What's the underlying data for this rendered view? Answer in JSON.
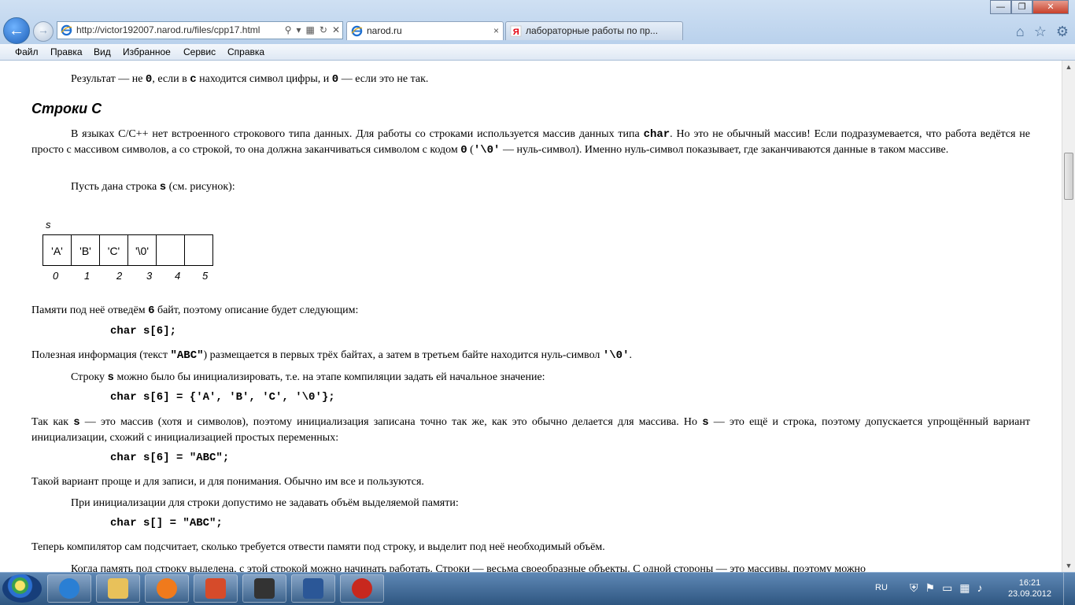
{
  "browser": {
    "address": "http://victor192007.narod.ru/files/cpp17.html",
    "tabs": [
      {
        "label": "narod.ru",
        "close": "×"
      },
      {
        "label": "лабораторные работы по пр..."
      }
    ],
    "window_controls": [
      "—",
      "❐",
      "✕"
    ],
    "menu": [
      "Файл",
      "Правка",
      "Вид",
      "Избранное",
      "Сервис",
      "Справка"
    ],
    "icons": [
      "home-icon",
      "star-icon",
      "gear-icon"
    ]
  },
  "page": {
    "p0": {
      "a": "Результат — не ",
      "b": "0",
      "c": ", если в ",
      "d": "c",
      "e": " находится символ цифры, и ",
      "f": "0",
      "g": " — если это не так."
    },
    "heading": "Строки С",
    "p1": {
      "a": "В языках C/C++ нет встроенного строкового типа данных. Для работы со строками используется массив данных типа ",
      "b": "char",
      "c": ". Но это не обычный массив! Если подразумевается, что работа ведётся не просто с массивом символов, а со строкой, то она должна заканчиваться символом с кодом ",
      "d": "0",
      "e": " (",
      "f": "'\\0'",
      "g": " — нуль-символ). Именно нуль-символ показывает, где заканчиваются данные в таком массиве."
    },
    "p2": {
      "a": "Пусть дана строка ",
      "b": "s",
      "c": " (см. рисунок):"
    },
    "figure": {
      "label": "s",
      "cells": [
        "'A'",
        "'B'",
        "'C'",
        "'\\0'",
        "",
        ""
      ],
      "indices": [
        "0",
        "1",
        "2",
        "3",
        "4",
        "5"
      ]
    },
    "p3": {
      "a": "Памяти под неё отведём ",
      "b": "6",
      "c": " байт, поэтому описание будет следующим:"
    },
    "code1": "char s[6];",
    "p4": {
      "a": "Полезная информация (текст ",
      "b": "\"ABC\"",
      "c": ") размещается в первых трёх байтах, а затем в третьем байте находится нуль-символ ",
      "d": "'\\0'",
      "e": "."
    },
    "p5": {
      "a": "Строку ",
      "b": "s",
      "c": " можно было бы инициализировать, т.е. на этапе компиляции задать ей начальное значение:"
    },
    "code2": "char s[6] = {'A', 'B', 'C', '\\0'};",
    "p6": {
      "a": "Так как ",
      "b": "s",
      "c": " — это массив (хотя и символов), поэтому инициализация записана точно так же, как это обычно делается для массива. Но ",
      "d": "s",
      "e": " — это ещё и строка, поэтому допускается упрощённый вариант инициализации, схожий с инициализацией простых переменных:"
    },
    "code3": "char s[6] = \"ABC\";",
    "p7": "Такой вариант проще и для записи, и для понимания. Обычно им все и пользуются.",
    "p8": "При инициализации для строки допустимо не задавать объём выделяемой памяти:",
    "code4": "char s[] = \"ABC\";",
    "p9": "Теперь компилятор сам подсчитает, сколько требуется отвести памяти под строку, и выделит под неё необходимый объём.",
    "p10": "Когда память под строку выделена, с этой строкой можно начинать работать. Строки — весьма своеобразные объекты. С одной стороны — это массивы, поэтому можно"
  },
  "taskbar": {
    "lang": "RU",
    "time": "16:21",
    "date": "23.09.2012",
    "apps": [
      {
        "icon": "internet-explorer-icon",
        "color": "#2a7fd4"
      },
      {
        "icon": "file-explorer-icon",
        "color": "#e8c15a"
      },
      {
        "icon": "media-player-icon",
        "color": "#f07a1c"
      },
      {
        "icon": "paint-icon",
        "color": "#d64b2a"
      },
      {
        "icon": "media-center-icon",
        "color": "#333333"
      },
      {
        "icon": "word-icon",
        "color": "#2b5797"
      },
      {
        "icon": "red-app-icon",
        "color": "#c8281e"
      }
    ]
  }
}
